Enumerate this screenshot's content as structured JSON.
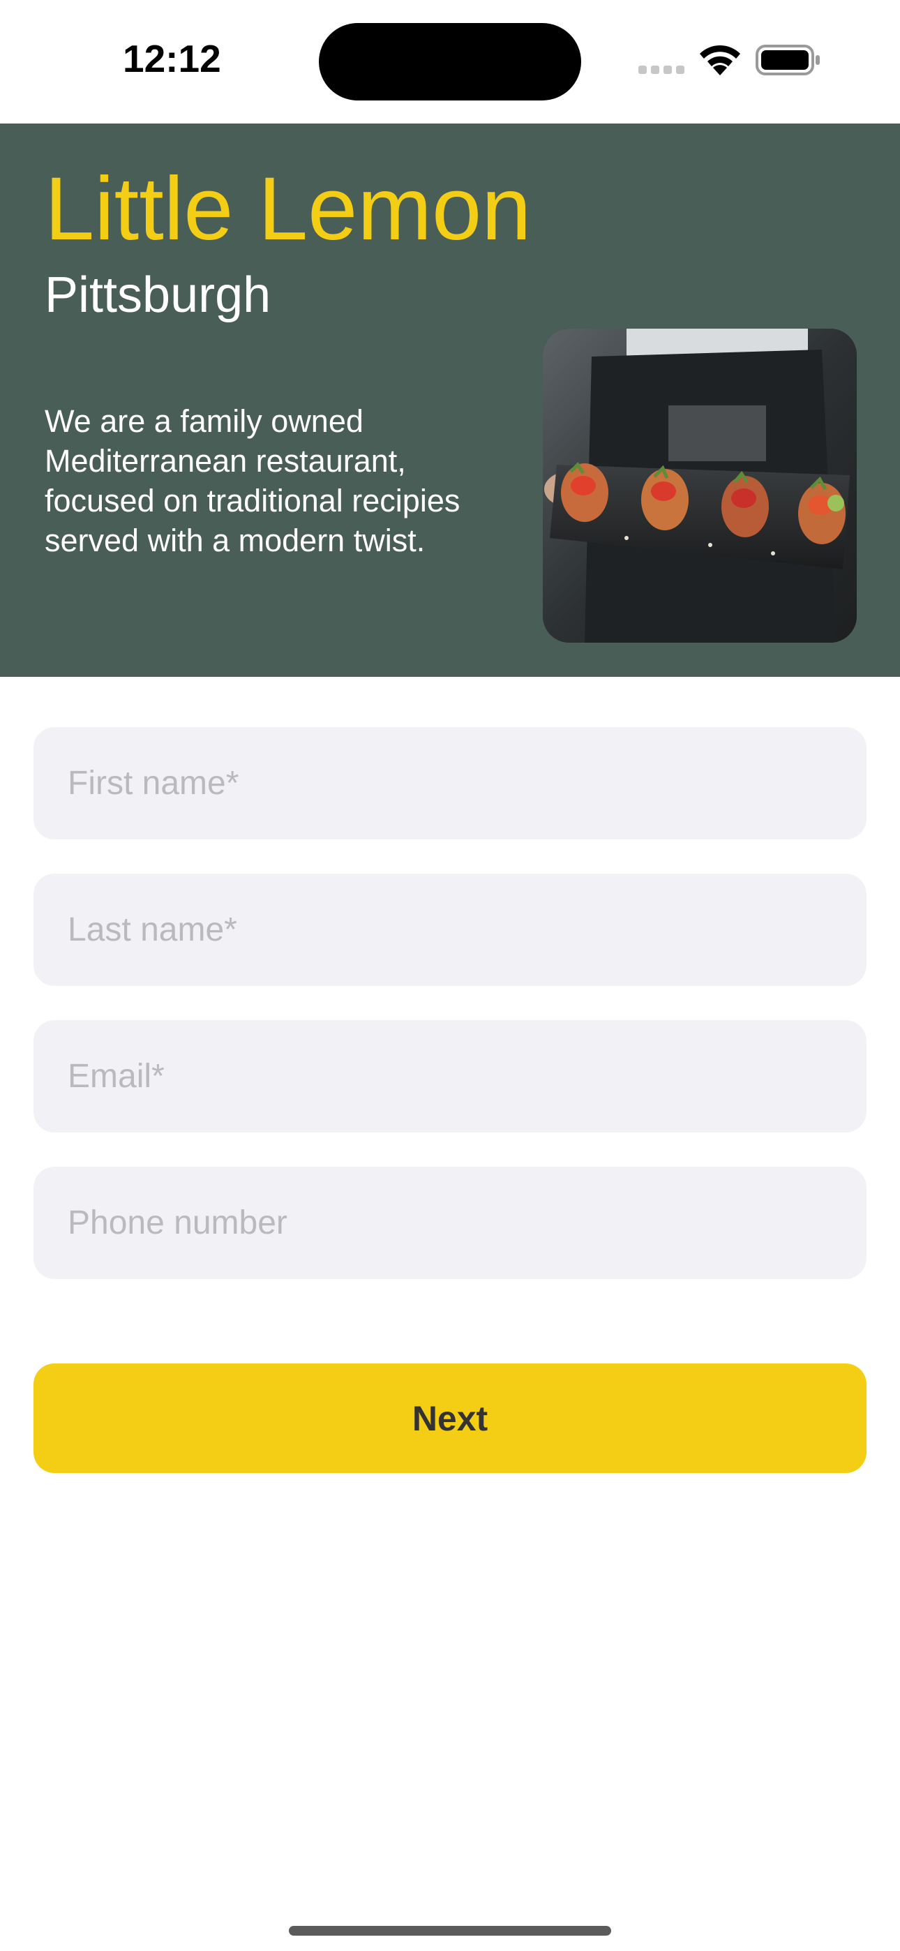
{
  "status_bar": {
    "time": "12:12",
    "icons": [
      "cellular-signal-icon",
      "wifi-icon",
      "battery-icon"
    ]
  },
  "hero": {
    "title": "Little Lemon",
    "subtitle": "Pittsburgh",
    "description": "We are a family owned Mediterranean restaurant, focused on traditional recipies served with a modern twist.",
    "image": "restaurant-dish-photo",
    "background_color": "#495e57",
    "title_color": "#f4ce14"
  },
  "form": {
    "first_name_placeholder": "First name*",
    "last_name_placeholder": "Last name*",
    "email_placeholder": "Email*",
    "phone_placeholder": "Phone number",
    "first_name_value": "",
    "last_name_value": "",
    "email_value": "",
    "phone_value": ""
  },
  "next_button": {
    "label": "Next",
    "color": "#f4ce14"
  }
}
